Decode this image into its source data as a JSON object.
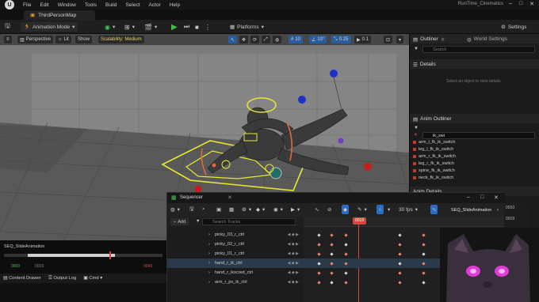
{
  "menubar": {
    "items": [
      "File",
      "Edit",
      "Window",
      "Tools",
      "Build",
      "Select",
      "Actor",
      "Help"
    ],
    "project": "RunTime_Cinematics"
  },
  "tab": {
    "label": "ThirdPersonMap"
  },
  "toolbar": {
    "mode": "Animation Mode",
    "platforms": "Platforms",
    "settings": "Settings"
  },
  "viewport": {
    "perspective": "Perspective",
    "lit": "Lit",
    "show": "Show",
    "scalability": "Scalability: Medium",
    "grid_snap": "10",
    "rot_snap": "10°",
    "scale_snap": "0.25",
    "cam_speed": "0.1"
  },
  "right": {
    "outliner_tab": "Outliner",
    "world_settings_tab": "World Settings",
    "search_placeholder": "Search",
    "details_tab": "Details",
    "details_empty": "Select an object to view details.",
    "anim_outliner_tab": "Anim Outliner",
    "anim_search": "ik_swi",
    "anim_items": [
      "arm_l_fk_ik_switch",
      "leg_l_fk_ik_switch",
      "arm_r_fk_ik_switch",
      "leg_r_fk_ik_switch",
      "spine_fk_ik_switch",
      "neck_fk_ik_switch"
    ],
    "anim_details_tab": "Anim Details"
  },
  "sequencer": {
    "title": "Sequencer",
    "fps": "30 fps",
    "sequence_name": "SEQ_SlideAnimation",
    "frame_badge": "0019",
    "add_label": "Add",
    "search_placeholder": "Search Tracks",
    "tracks": [
      "pinky_03_r_ctrl",
      "pinky_02_r_ctrl",
      "pinky_01_r_ctrl",
      "hand_r_ik_ctrl",
      "hand_r_ikxcred_ctrl",
      "arm_r_pv_ik_ctrl"
    ],
    "right_vals": [
      "0010",
      "0019"
    ]
  },
  "anim_strip": {
    "title": "SEQ_SlideAnimation",
    "start": "0000",
    "mid": "0019",
    "end": "0043"
  },
  "bottom": {
    "content_drawer": "Content Drawer",
    "output_log": "Output Log",
    "cmd": "Cmd"
  },
  "colors": {
    "accent_blue": "#2b6cc4",
    "play_green": "#3ec13e",
    "key_orange": "#e9876d",
    "playhead_red": "#d9453a",
    "control_yellow": "#e8e830"
  }
}
